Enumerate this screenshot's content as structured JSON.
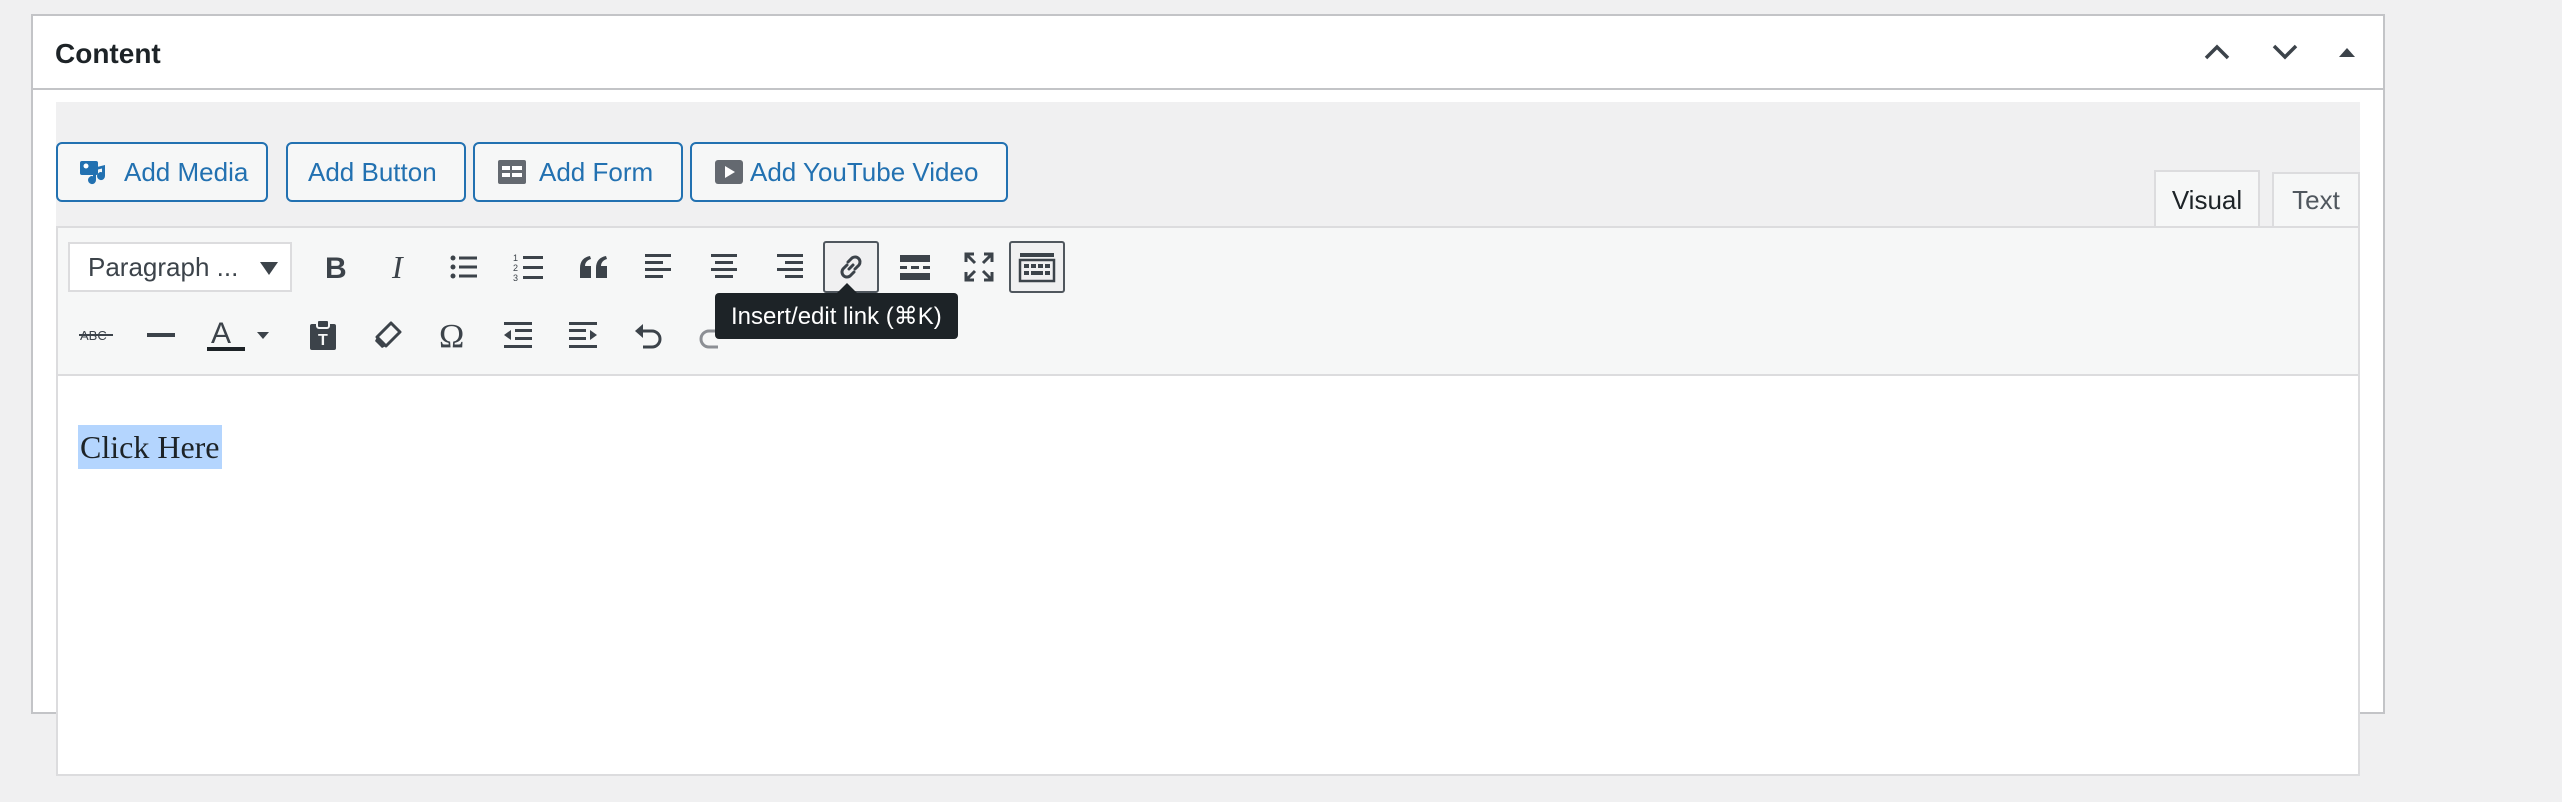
{
  "metabox": {
    "title": "Content",
    "controls": [
      "move-up-icon",
      "move-down-icon",
      "toggle-panel-icon"
    ]
  },
  "media_buttons": {
    "add_media": "Add Media",
    "add_button": "Add Button",
    "add_form": "Add Form",
    "add_youtube": "Add YouTube Video"
  },
  "editor_tabs": {
    "visual": "Visual",
    "text": "Text",
    "active": "visual"
  },
  "toolbar": {
    "format_select": "Paragraph ...",
    "row1": [
      "bold-icon",
      "italic-icon",
      "bulleted-list-icon",
      "numbered-list-icon",
      "blockquote-icon",
      "align-left-icon",
      "align-center-icon",
      "align-right-icon",
      "link-icon",
      "read-more-icon",
      "fullscreen-icon",
      "toolbar-toggle-icon"
    ],
    "row2": [
      "strikethrough-icon",
      "horizontal-line-icon",
      "text-color-icon",
      "paste-text-icon",
      "clear-formatting-icon",
      "special-character-icon",
      "outdent-icon",
      "indent-icon",
      "undo-icon",
      "redo-icon"
    ],
    "active_button": "link-icon"
  },
  "tooltip": {
    "text": "Insert/edit link (⌘K)"
  },
  "content": {
    "text": "Click Here",
    "selected": true
  },
  "colors": {
    "accent": "#2271b1",
    "selection": "#b4d5fe",
    "tooltip_bg": "#1d2327"
  }
}
